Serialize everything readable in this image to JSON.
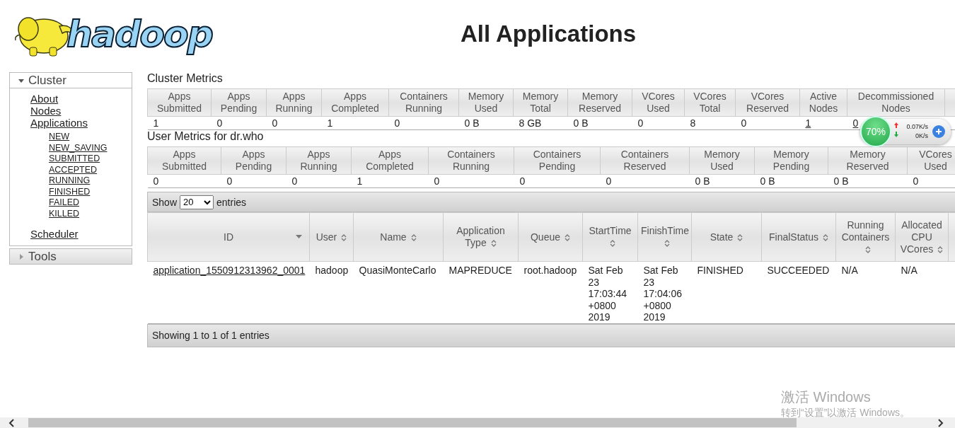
{
  "logo": {
    "text": "hadoop"
  },
  "title": "All Applications",
  "sidebar": [
    {
      "label": "Cluster",
      "expanded": true,
      "items": [
        {
          "label": "About"
        },
        {
          "label": "Nodes"
        },
        {
          "label": "Applications",
          "children": [
            {
              "label": "NEW"
            },
            {
              "label": "NEW_SAVING"
            },
            {
              "label": "SUBMITTED"
            },
            {
              "label": "ACCEPTED"
            },
            {
              "label": "RUNNING"
            },
            {
              "label": "FINISHED"
            },
            {
              "label": "FAILED"
            },
            {
              "label": "KILLED"
            }
          ]
        },
        {
          "label": "Scheduler"
        }
      ]
    },
    {
      "label": "Tools",
      "expanded": false
    }
  ],
  "cluster_metrics": {
    "title": "Cluster Metrics",
    "columns": [
      [
        "Apps",
        "Submitted"
      ],
      [
        "Apps",
        "Pending"
      ],
      [
        "Apps",
        "Running"
      ],
      [
        "Apps",
        "Completed"
      ],
      [
        "Containers",
        "Running"
      ],
      [
        "Memory",
        "Used"
      ],
      [
        "Memory",
        "Total"
      ],
      [
        "Memory",
        "Reserved"
      ],
      [
        "VCores",
        "Used"
      ],
      [
        "VCores",
        "Total"
      ],
      [
        "VCores",
        "Reserved"
      ],
      [
        "Active",
        "Nodes"
      ],
      [
        "Decommissioned",
        "Nodes"
      ]
    ],
    "row": [
      {
        "text": "1",
        "link": false
      },
      {
        "text": "0",
        "link": false
      },
      {
        "text": "0",
        "link": false
      },
      {
        "text": "1",
        "link": false
      },
      {
        "text": "0",
        "link": false
      },
      {
        "text": "0 B",
        "link": false
      },
      {
        "text": "8 GB",
        "link": false
      },
      {
        "text": "0 B",
        "link": false
      },
      {
        "text": "0",
        "link": false
      },
      {
        "text": "8",
        "link": false
      },
      {
        "text": "0",
        "link": false
      },
      {
        "text": "1",
        "link": true
      },
      {
        "text": "0",
        "link": true
      }
    ]
  },
  "user_metrics": {
    "title": "User Metrics for dr.who",
    "columns": [
      [
        "Apps",
        "Submitted"
      ],
      [
        "Apps",
        "Pending"
      ],
      [
        "Apps",
        "Running"
      ],
      [
        "Apps",
        "Completed"
      ],
      [
        "Containers",
        "Running"
      ],
      [
        "Containers",
        "Pending"
      ],
      [
        "Containers",
        "Reserved"
      ],
      [
        "Memory",
        "Used"
      ],
      [
        "Memory",
        "Pending"
      ],
      [
        "Memory",
        "Reserved"
      ],
      [
        "VCores",
        "Used"
      ]
    ],
    "row": [
      "0",
      "0",
      "0",
      "1",
      "0",
      "0",
      "0",
      "0 B",
      "0 B",
      "0 B",
      "0"
    ]
  },
  "applications": {
    "show_label": "Show",
    "page_size": "20",
    "entries_label": "entries",
    "columns": [
      {
        "label": "ID",
        "sorted": true
      },
      {
        "label": "User",
        "sorted": false
      },
      {
        "label": "Name",
        "sorted": false
      },
      {
        "label": "Application Type",
        "sorted": false
      },
      {
        "label": "Queue",
        "sorted": false
      },
      {
        "label": "StartTime",
        "sorted": false
      },
      {
        "label": "FinishTime",
        "sorted": false
      },
      {
        "label": "State",
        "sorted": false
      },
      {
        "label": "FinalStatus",
        "sorted": false
      },
      {
        "label": "Running Containers",
        "sorted": false
      },
      {
        "label": "Allocated CPU VCores",
        "sorted": false
      }
    ],
    "rows": [
      [
        "application_1550912313962_0001",
        "hadoop",
        "QuasiMonteCarlo",
        "MAPREDUCE",
        "root.hadoop",
        "Sat Feb 23 17:03:44 +0800 2019",
        "Sat Feb 23 17:04:06 +0800 2019",
        "FINISHED",
        "SUCCEEDED",
        "N/A",
        "N/A"
      ]
    ],
    "footer": "Showing 1 to 1 of 1 entries"
  },
  "speed_widget": {
    "percent": "70%",
    "upload": "0.07K/s",
    "download": "0K/s"
  },
  "os_notice": {
    "title": "激活 Windows",
    "subtitle": "转到“设置”以激活 Windows。"
  }
}
